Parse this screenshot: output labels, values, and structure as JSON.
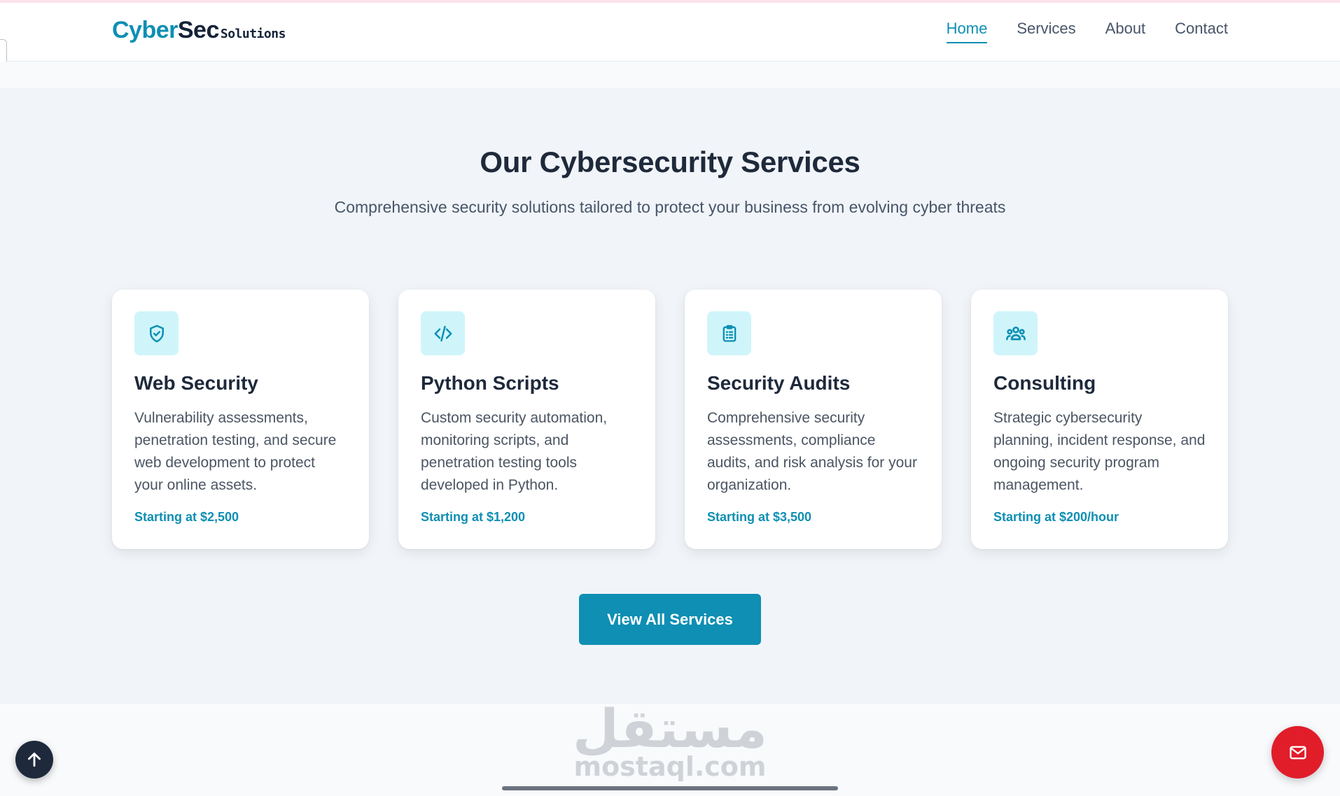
{
  "header": {
    "logo": {
      "part1": "Cyber",
      "part2": "Sec",
      "part3": "Solutions"
    },
    "nav": [
      {
        "label": "Home",
        "active": true
      },
      {
        "label": "Services",
        "active": false
      },
      {
        "label": "About",
        "active": false
      },
      {
        "label": "Contact",
        "active": false
      }
    ]
  },
  "services": {
    "title": "Our Cybersecurity Services",
    "subtitle": "Comprehensive security solutions tailored to protect your business from evolving cyber threats",
    "cards": [
      {
        "icon": "shield-check-icon",
        "title": "Web Security",
        "description": "Vulnerability assessments, penetration testing, and secure web development to protect your online assets.",
        "price": "Starting at $2,500"
      },
      {
        "icon": "code-icon",
        "title": "Python Scripts",
        "description": "Custom security automation, monitoring scripts, and penetration testing tools developed in Python.",
        "price": "Starting at $1,200"
      },
      {
        "icon": "clipboard-icon",
        "title": "Security Audits",
        "description": "Comprehensive security assessments, compliance audits, and risk analysis for your organization.",
        "price": "Starting at $3,500"
      },
      {
        "icon": "users-icon",
        "title": "Consulting",
        "description": "Strategic cybersecurity planning, incident response, and ongoing security program management.",
        "price": "Starting at $200/hour"
      }
    ],
    "cta_label": "View All Services"
  },
  "watermark": {
    "arabic": "مستقل",
    "latin": "mostaql.com"
  },
  "colors": {
    "accent": "#0e8fb3",
    "dark": "#1e293b",
    "mail_button": "#e11d2a",
    "icon_bg": "#cff5fb"
  }
}
